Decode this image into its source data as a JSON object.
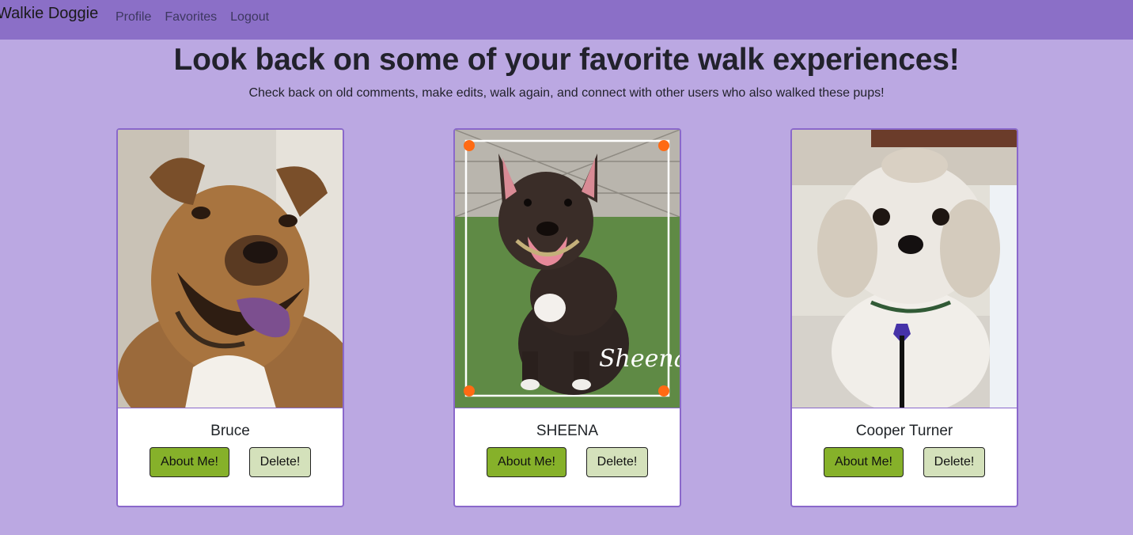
{
  "nav": {
    "brand": "Walkie Doggie",
    "links": [
      "Profile",
      "Favorites",
      "Logout"
    ]
  },
  "header": {
    "title": "Look back on some of your favorite walk experiences!",
    "subtitle": "Check back on old comments, make edits, walk again, and connect with other users who also walked these pups!"
  },
  "cards": [
    {
      "name": "Bruce",
      "about_label": "About Me!",
      "delete_label": "Delete!"
    },
    {
      "name": "SHEENA",
      "about_label": "About Me!",
      "delete_label": "Delete!",
      "photo_caption": "Sheena"
    },
    {
      "name": "Cooper Turner",
      "about_label": "About Me!",
      "delete_label": "Delete!"
    }
  ],
  "colors": {
    "page_bg": "#bba8e2",
    "navbar_bg": "#8b6fc7",
    "card_border": "#8a68cb",
    "about_button": "#86b12a",
    "delete_button": "#d4e1bb"
  }
}
